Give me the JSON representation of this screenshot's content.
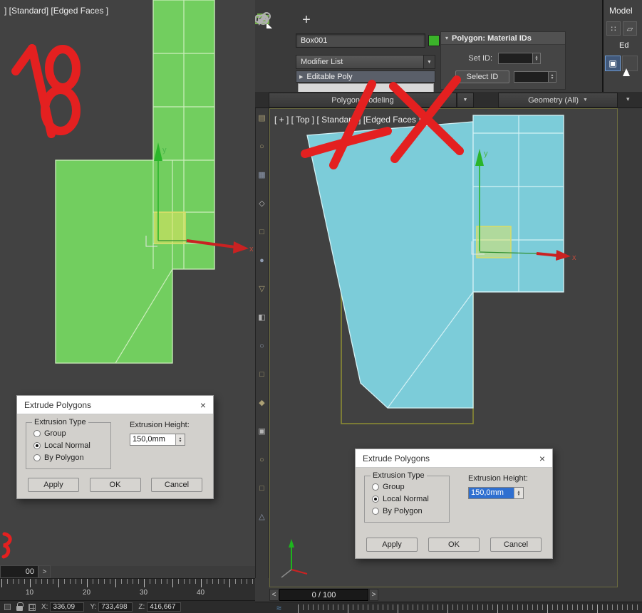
{
  "left_viewport": {
    "label": "] [Standard] [Edged Faces ]",
    "annotation": "18"
  },
  "right_viewport": {
    "label": "[ + ] [ Top ] [ Standard ] [Edged Faces ]",
    "annotation": "1X"
  },
  "axis": {
    "x": "x",
    "y": "y"
  },
  "header": {
    "object_name": "Box001",
    "modifier_list": "Modifier List",
    "stack_item": "Editable Poly"
  },
  "material_panel": {
    "title": "Polygon: Material IDs",
    "set_id_label": "Set ID:",
    "set_id_value": "",
    "select_id": "Select ID",
    "select_id_value": ""
  },
  "side_panel": {
    "title": "Model",
    "ed": "Ed"
  },
  "tabs": {
    "polygon_modeling": "Polygon Modeling",
    "geometry": "Geometry (All)"
  },
  "extrude_dialog": {
    "title": "Extrude Polygons",
    "type_group_label": "Extrusion Type",
    "radio_group": "Group",
    "radio_local_normal": "Local Normal",
    "radio_by_polygon": "By Polygon",
    "selected_option": "Local Normal",
    "height_label": "Extrusion Height:",
    "height_value": "150,0mm",
    "apply": "Apply",
    "ok": "OK",
    "cancel": "Cancel"
  },
  "timeline_left": {
    "frame_field": "00",
    "numbers": [
      "10",
      "20",
      "30",
      "40"
    ]
  },
  "timeline_right": {
    "frame_display": "0 / 100"
  },
  "status_bar": {
    "x_label": "X:",
    "x_value": "336,09",
    "y_label": "Y:",
    "y_value": "733,498",
    "z_label": "Z:",
    "z_value": "416,667"
  },
  "icons": {
    "close": "×",
    "dropdown_arrow": "▼",
    "rollout_arrow": "▾",
    "expander_arrow": "▶",
    "spin_up": "▲",
    "spin_down": "▼",
    "plus": "+",
    "prev": "<",
    "next": ">",
    "wave": "≈",
    "dots": "∷",
    "diamond": "▱",
    "modify_glyph": "▣",
    "chevron": "▾"
  },
  "ribbon_icons": [
    "▤",
    "○",
    "▦",
    "◇",
    "□",
    "●",
    "▽",
    "◧",
    "○",
    "□",
    "◆",
    "▣",
    "○",
    "□",
    "△"
  ]
}
